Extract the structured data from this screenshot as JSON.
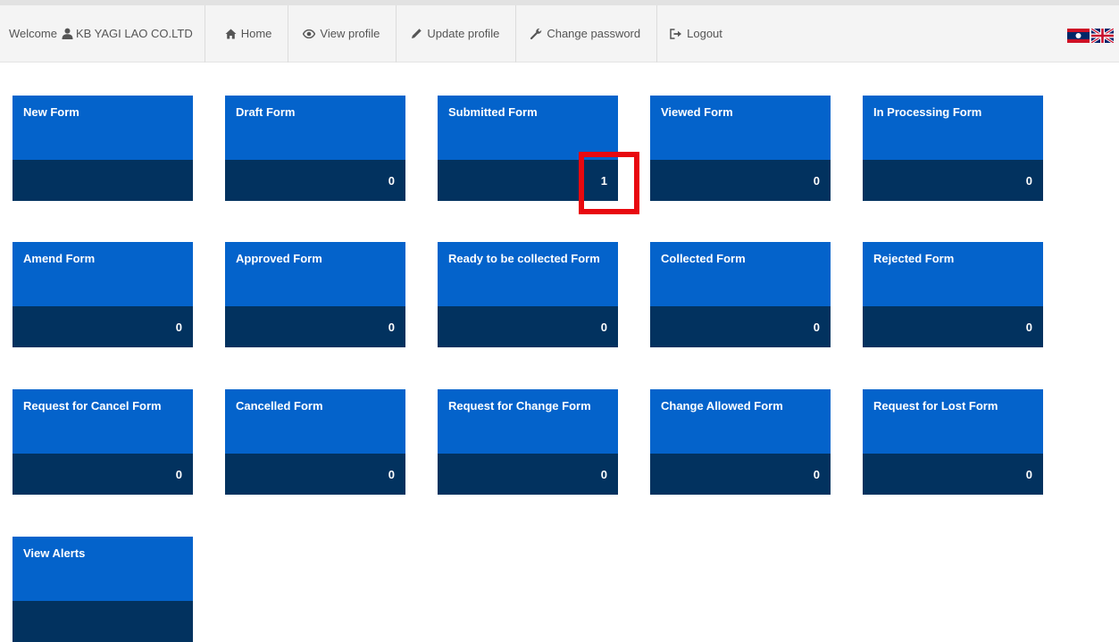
{
  "nav": {
    "welcome_label": "Welcome",
    "company": "KB YAGI LAO CO.LTD",
    "home": "Home",
    "view_profile": "View profile",
    "update_profile": "Update profile",
    "change_password": "Change password",
    "logout": "Logout"
  },
  "languages": [
    "lao-flag",
    "uk-flag"
  ],
  "colors": {
    "tile_top": "#0463cb",
    "tile_bottom": "#02325f",
    "highlight": "#e8090f"
  },
  "tiles": [
    {
      "label": "New Form",
      "count": ""
    },
    {
      "label": "Draft Form",
      "count": "0"
    },
    {
      "label": "Submitted Form",
      "count": "1"
    },
    {
      "label": "Viewed Form",
      "count": "0"
    },
    {
      "label": "In Processing Form",
      "count": "0"
    },
    {
      "label": "Amend Form",
      "count": "0"
    },
    {
      "label": "Approved Form",
      "count": "0"
    },
    {
      "label": "Ready to be collected Form",
      "count": "0"
    },
    {
      "label": "Collected Form",
      "count": "0"
    },
    {
      "label": "Rejected Form",
      "count": "0"
    },
    {
      "label": "Request for Cancel Form",
      "count": "0"
    },
    {
      "label": "Cancelled Form",
      "count": "0"
    },
    {
      "label": "Request for Change Form",
      "count": "0"
    },
    {
      "label": "Change Allowed Form",
      "count": "0"
    },
    {
      "label": "Request for Lost Form",
      "count": "0"
    },
    {
      "label": "View Alerts",
      "count": ""
    }
  ]
}
